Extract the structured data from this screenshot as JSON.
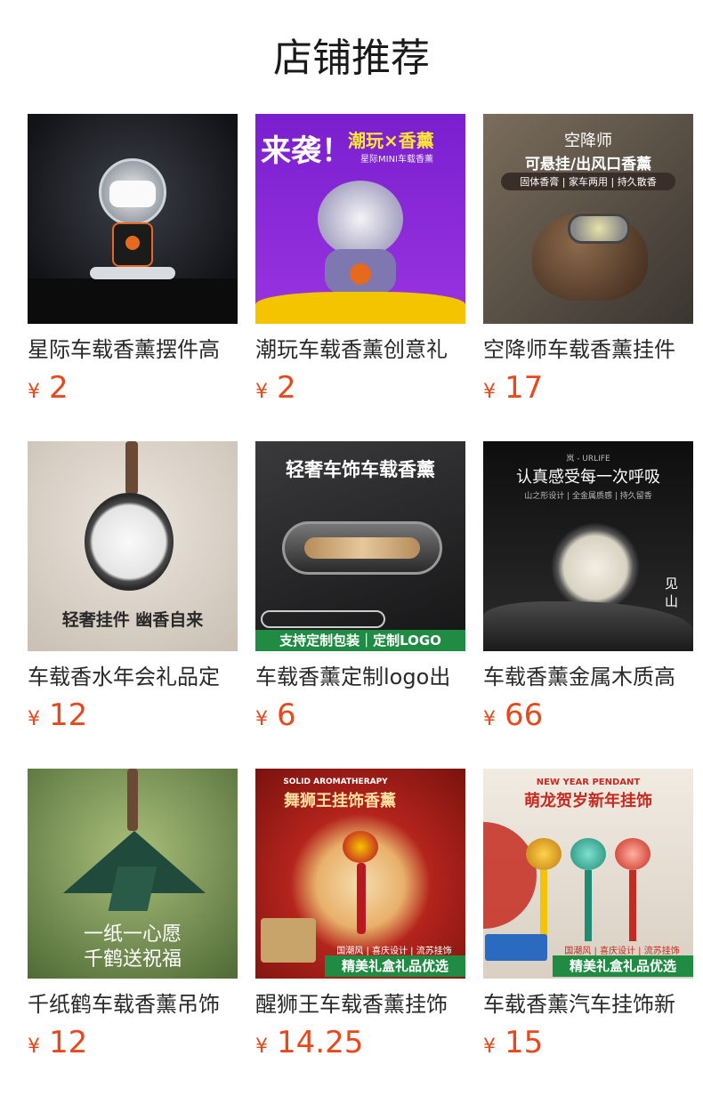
{
  "page": {
    "title": "店铺推荐"
  },
  "products": [
    {
      "name": "星际车载香薰摆件高",
      "currency": "¥",
      "price": "2",
      "thumb": {
        "bg": "#1d1f24",
        "icon": "astronaut-figure-icon"
      }
    },
    {
      "name": "潮玩车载香薰创意礼",
      "currency": "¥",
      "price": "2",
      "thumb": {
        "bg": "#8a27d6",
        "headline": "来袭！",
        "banner": "潮玩×香薰",
        "sub": "星际MINI车载香薰",
        "icon": "astronaut-figure-icon"
      }
    },
    {
      "name": "空降师车载香薰挂件",
      "currency": "¥",
      "price": "17",
      "thumb": {
        "bg": "#5a5044",
        "line1": "空降师",
        "line2": "可悬挂/出风口香薰",
        "line3": "固体香膏 | 家车两用 | 持久散香",
        "icon": "pilot-helmet-icon"
      }
    },
    {
      "name": "车载香水年会礼品定",
      "currency": "¥",
      "price": "12",
      "thumb": {
        "bg": "#d8d0c6",
        "headline": "轻奢挂件 幽香自来",
        "icon": "round-pendant-icon"
      }
    },
    {
      "name": "车载香薰定制logo出",
      "currency": "¥",
      "price": "6",
      "thumb": {
        "bg": "#2a2a2c",
        "headline": "轻奢车饰车载香薰",
        "banner": "支持定制包装｜定制LOGO",
        "icon": "vent-clip-icon"
      }
    },
    {
      "name": "车载香薰金属木质高",
      "currency": "¥",
      "price": "66",
      "thumb": {
        "bg": "#151515",
        "brand": "岚 - URLIFE",
        "headline": "认真感受每一次呼吸",
        "sub": "山之形设计 | 全金属质感 | 持久留香",
        "side": "见山",
        "icon": "metal-tin-icon"
      }
    },
    {
      "name": "千纸鹤车载香薰吊饰",
      "currency": "¥",
      "price": "12",
      "thumb": {
        "bg": "#6f8a4c",
        "line1": "一纸一心愿",
        "line2": "千鹤送祝福",
        "icon": "paper-crane-icon"
      }
    },
    {
      "name": "醒狮王车载香薰挂饰",
      "currency": "¥",
      "price": "14.25",
      "thumb": {
        "bg": "#b3241c",
        "top": "SOLID AROMATHERAPY",
        "headline": "舞狮王挂饰香薰",
        "tags": "国潮风 | 喜庆设计 | 流苏挂饰",
        "banner": "精美礼盒礼品优选",
        "icon": "lion-dance-icon"
      }
    },
    {
      "name": "车载香薰汽车挂饰新",
      "currency": "¥",
      "price": "15",
      "thumb": {
        "bg": "#e9e2d8",
        "top": "NEW YEAR PENDANT",
        "headline": "萌龙贺岁新年挂饰",
        "tags": "国潮风 | 喜庆设计 | 流苏挂饰",
        "banner": "精美礼盒礼品优选",
        "icon": "dragon-pendant-icon"
      }
    }
  ]
}
